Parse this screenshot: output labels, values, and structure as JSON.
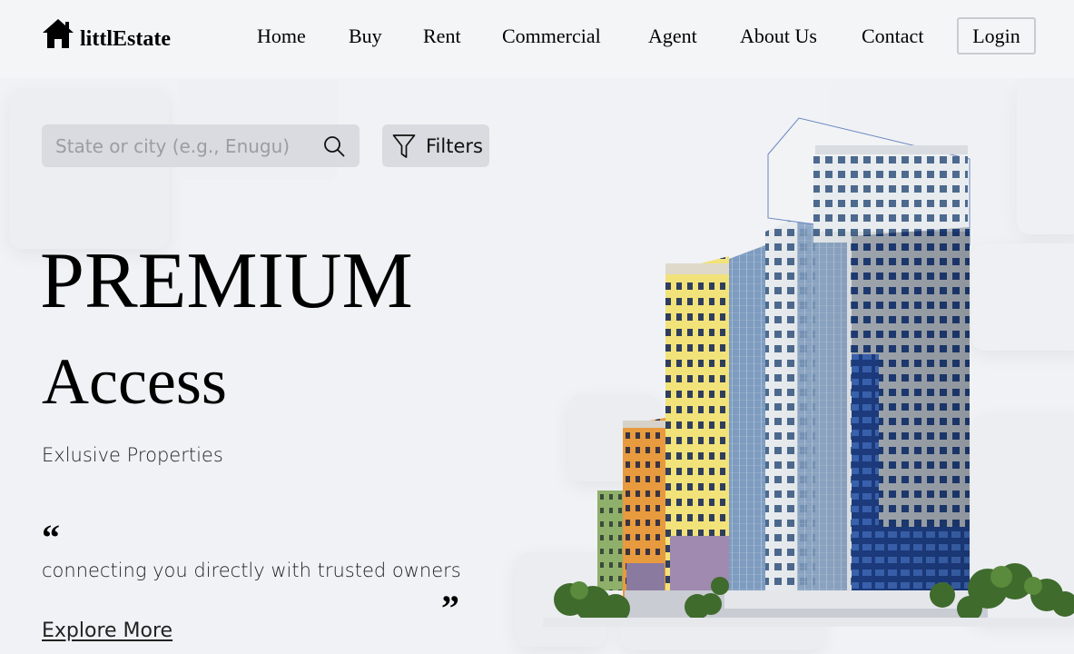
{
  "brand": {
    "name": "littlEstate"
  },
  "nav": {
    "items": [
      {
        "label": "Home"
      },
      {
        "label": "Buy"
      },
      {
        "label": "Rent"
      },
      {
        "label": "Commercial"
      },
      {
        "label": "Agent"
      },
      {
        "label": "About Us"
      },
      {
        "label": "Contact"
      }
    ],
    "login_label": "Login"
  },
  "search": {
    "placeholder": "State or city (e.g., Enugu)",
    "value": "",
    "icon": "search-icon"
  },
  "filters": {
    "label": "Filters",
    "icon": "funnel-icon"
  },
  "hero": {
    "title_line1": "PREMIUM",
    "title_line2": "Access",
    "subtitle": "Exlusive Properties",
    "quote_open": "“",
    "quote_text": "connecting you directly with trusted owners",
    "quote_close": "”",
    "cta_label": "Explore More"
  },
  "colors": {
    "background": "#f1f2f5",
    "input_bg": "#d9dbe0",
    "text": "#000000"
  }
}
